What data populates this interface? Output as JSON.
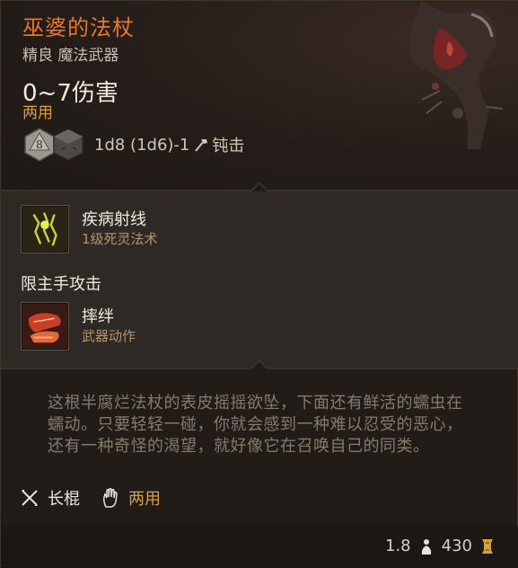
{
  "item": {
    "name": "巫婆的法杖",
    "rarity_type": "精良 魔法武器",
    "damage": "0~7伤害",
    "handedness": "两用",
    "dice_formula": "1d8 (1d6)-1",
    "damage_type": "钝击",
    "dice": [
      "8",
      ""
    ]
  },
  "abilities": [
    {
      "name": "疾病射线",
      "type": "1级死灵法术",
      "icon": "disease-ray-icon"
    },
    {
      "name": "摔绊",
      "type": "武器动作",
      "icon": "topple-icon"
    }
  ],
  "restriction": "限主手攻击",
  "description": "这根半腐烂法杖的表皮摇摇欲坠，下面还有鲜活的蠕虫在蠕动。只要轻轻一碰，你就会感到一种难以忍受的恶心，还有一种奇怪的渴望，就好像它在召唤自己的同类。",
  "tags": [
    {
      "label": "长棍",
      "icon": "quarterstaff-icon"
    },
    {
      "label": "两用",
      "icon": "hand-icon"
    }
  ],
  "footer": {
    "weight": "1.8",
    "value": "430"
  },
  "colors": {
    "title": "#e8762d",
    "gold": "#d9a03a",
    "ability_type": "#b8926a",
    "description": "#857a70"
  }
}
